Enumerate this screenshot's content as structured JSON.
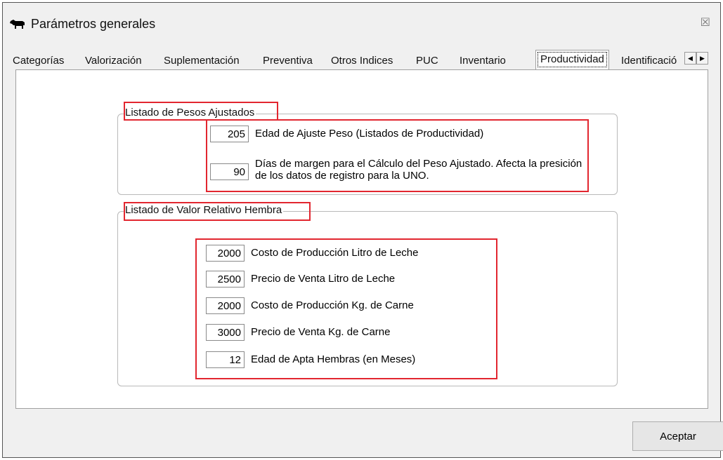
{
  "window": {
    "title": "Parámetros generales",
    "close_glyph": "☒"
  },
  "tabs": [
    {
      "label": "Categorías"
    },
    {
      "label": "Valorización"
    },
    {
      "label": "Suplementación"
    },
    {
      "label": "Preventiva"
    },
    {
      "label": "Otros Indices"
    },
    {
      "label": "PUC"
    },
    {
      "label": "Inventario"
    },
    {
      "label": "Productividad"
    },
    {
      "label": "Identificación"
    }
  ],
  "active_tab": "Productividad",
  "pesos_ajustados": {
    "title": "Listado de Pesos Ajustados",
    "fields": [
      {
        "value": "205",
        "label": "Edad de Ajuste Peso (Listados de Productividad)"
      },
      {
        "value": "90",
        "label": "Días de margen para el Cálculo del Peso Ajustado. Afecta la presición de los datos de registro para la UNO."
      }
    ]
  },
  "valor_relativo": {
    "title": "Listado de Valor Relativo Hembra",
    "fields": [
      {
        "value": "2000",
        "label": "Costo de Producción Litro de Leche"
      },
      {
        "value": "2500",
        "label": "Precio de Venta Litro de Leche"
      },
      {
        "value": "2000",
        "label": "Costo de Producción Kg. de Carne"
      },
      {
        "value": "3000",
        "label": "Precio de Venta Kg. de Carne"
      },
      {
        "value": "12",
        "label": "Edad de Apta Hembras (en Meses)"
      }
    ]
  },
  "footer": {
    "accept_label": "Aceptar"
  },
  "colors": {
    "highlight": "#e2262f",
    "panel_bg": "#ffffff",
    "window_bg": "#f0f0f0"
  }
}
